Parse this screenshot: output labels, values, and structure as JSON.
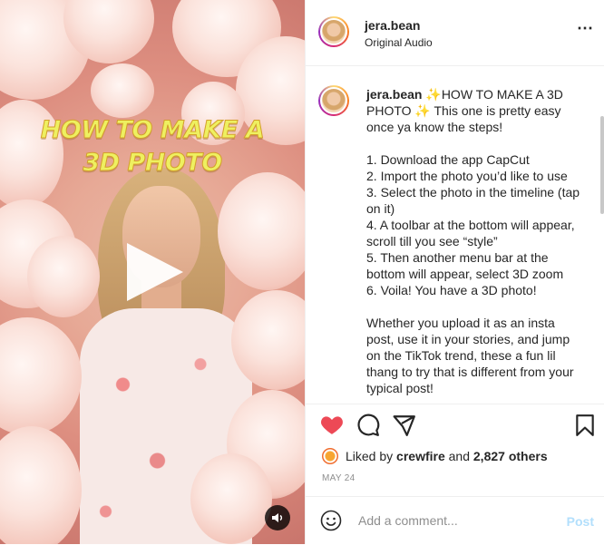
{
  "post": {
    "username": "jera.bean",
    "audio": "Original Audio",
    "more_icon": "more-dots-icon"
  },
  "media": {
    "overlay_line1": "HOW TO MAKE A",
    "overlay_line2": "3D PHOTO",
    "play_icon": "play-icon",
    "mute_icon": "speaker-icon"
  },
  "caption": {
    "username": "jera.bean",
    "emoji_sparkle": "✨",
    "title": "HOW TO MAKE A 3D PHOTO",
    "intro": "This one is pretty easy once ya know the steps!",
    "steps": [
      "1. Download the app CapCut",
      "2. Import the photo you’d like to use",
      "3. Select the photo in the timeline (tap on it)",
      "4. A toolbar at the bottom will appear, scroll till you see “style”",
      "5. Then another menu bar at the bottom will appear, select 3D zoom",
      "6. Voila! You have a 3D photo!"
    ],
    "outro": "Whether you upload it as an insta post, use it in your stories, and jump on the TikTok trend, these a fun lil thang to try that is different from your typical post!"
  },
  "actions": {
    "like_icon": "heart-icon",
    "comment_icon": "comment-icon",
    "share_icon": "share-icon",
    "save_icon": "bookmark-icon",
    "liked_color": "#ed4956"
  },
  "likes": {
    "prefix": "Liked by",
    "user": "crewfire",
    "and": "and",
    "others": "2,827 others"
  },
  "date": "MAY 24",
  "comment": {
    "placeholder": "Add a comment...",
    "post_label": "Post",
    "emoji_icon": "emoji-icon"
  }
}
